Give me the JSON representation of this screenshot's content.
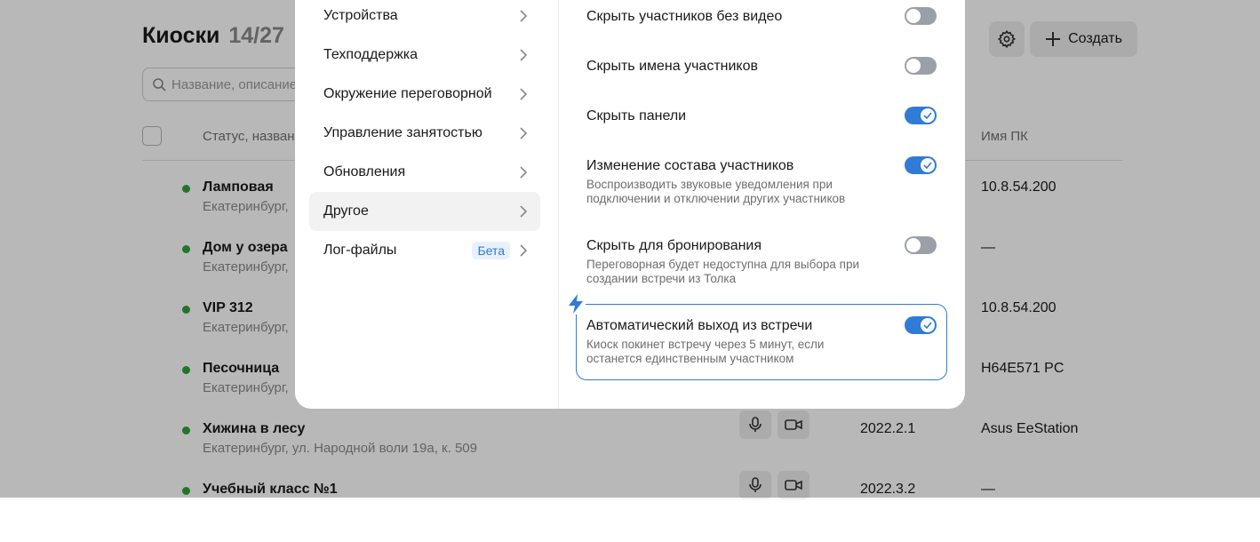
{
  "page": {
    "title": "Киоски",
    "count": "14/27",
    "settings_icon": "gear-icon",
    "create_label": "Создать",
    "search_placeholder": "Название, описание",
    "columns": {
      "status": "Статус, название",
      "pc_name": "Имя ПК"
    },
    "rows": [
      {
        "name": "Ламповая",
        "address": "Екатеринбург,",
        "version": "",
        "pc": "10.8.54.200",
        "devices": false
      },
      {
        "name": "Дом у озера",
        "address": "Екатеринбург,",
        "version": "",
        "pc": "—",
        "devices": false
      },
      {
        "name": "VIP 312",
        "address": "Екатеринбург,",
        "version": "",
        "pc": "10.8.54.200",
        "devices": false
      },
      {
        "name": "Песочница",
        "address": "Екатеринбург,",
        "version": "",
        "pc": "H64E571 PC",
        "devices": false
      },
      {
        "name": "Хижина в лесу",
        "address": "Екатеринбург, ул. Народной воли 19а, к. 509",
        "version": "2022.2.1",
        "pc": "Asus EeStation",
        "devices": true
      },
      {
        "name": "Учебный класс №1",
        "address": "",
        "version": "2022.3.2",
        "pc": "—",
        "devices": true
      }
    ],
    "status_color": "#2fa33a"
  },
  "modal": {
    "menu": [
      {
        "label": "Устройства",
        "active": false
      },
      {
        "label": "Техподдержка",
        "active": false
      },
      {
        "label": "Окружение переговорной",
        "active": false
      },
      {
        "label": "Управление занятостью",
        "active": false
      },
      {
        "label": "Обновления",
        "active": false
      },
      {
        "label": "Другое",
        "active": true
      },
      {
        "label": "Лог-файлы",
        "active": false,
        "badge": "Бета"
      }
    ],
    "settings": [
      {
        "title": "Скрыть участников без видео",
        "desc": "",
        "on": false
      },
      {
        "title": "Скрыть имена участников",
        "desc": "",
        "on": false
      },
      {
        "title": "Скрыть панели",
        "desc": "",
        "on": true
      },
      {
        "title": "Изменение состава участников",
        "desc": "Воспроизводить звуковые уведомления при подключении и отключении других участников",
        "on": true
      },
      {
        "title": "Скрыть для бронирования",
        "desc": "Переговорная будет недоступна для выбора при создании встречи из Толка",
        "on": false
      },
      {
        "title": "Автоматический выход из встречи",
        "desc": "Киоск покинет встречу через 5 минут, если останется единственным участником",
        "on": true,
        "highlighted": true
      }
    ],
    "accent_color": "#2f7bd6",
    "toggle_off_color": "#9ba0a8"
  }
}
